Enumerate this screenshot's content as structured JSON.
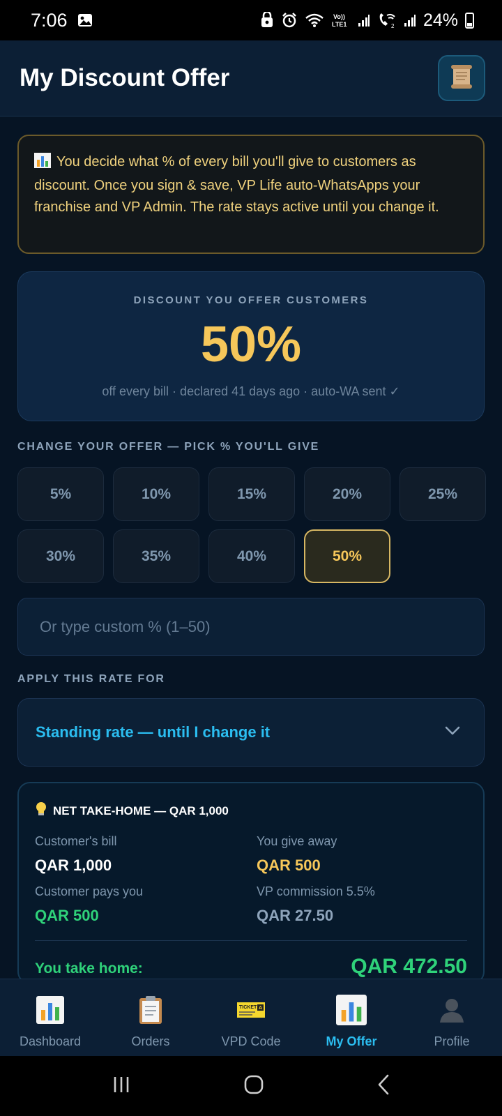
{
  "status_bar": {
    "time": "7:06",
    "battery": "24%",
    "icons": [
      "gallery-icon",
      "vpn-icon",
      "alarm-icon",
      "wifi-icon",
      "volte-icon",
      "signal-icon",
      "wifi-calling-icon",
      "signal-icon",
      "battery-icon"
    ]
  },
  "header": {
    "title": "My Discount Offer",
    "scroll_icon": "scroll-icon"
  },
  "info": {
    "icon": "bar-chart-icon",
    "text": "You decide what % of every bill you'll give to customers as discount. Once you sign & save, VP Life auto-WhatsApps your franchise and VP Admin. The rate stays active until you change it."
  },
  "discount_card": {
    "label": "DISCOUNT YOU OFFER CUSTOMERS",
    "value": "50%",
    "subtext": "off every bill · declared 41 days ago · auto-WA sent ✓"
  },
  "change_offer": {
    "label": "CHANGE YOUR OFFER — PICK % YOU'LL GIVE",
    "options": [
      "5%",
      "10%",
      "15%",
      "20%",
      "25%",
      "30%",
      "35%",
      "40%",
      "50%"
    ],
    "selected": "50%"
  },
  "custom_input": {
    "placeholder": "Or type custom % (1–50)",
    "value": ""
  },
  "apply": {
    "label": "APPLY THIS RATE FOR",
    "selected": "Standing rate — until I change it"
  },
  "net": {
    "title": "NET TAKE-HOME — QAR 1,000",
    "icon": "lightbulb-icon",
    "customer_bill_label": "Customer's bill",
    "customer_bill_value": "QAR 1,000",
    "give_away_label": "You give away",
    "give_away_value": "QAR 500",
    "customer_pays_label": "Customer pays you",
    "customer_pays_value": "QAR 500",
    "commission_label": "VP commission 5.5%",
    "commission_value": "QAR 27.50",
    "take_home_label": "You take home:",
    "take_home_value": "QAR 472.50"
  },
  "bottom_nav": [
    {
      "label": "Dashboard",
      "icon": "bar-chart-icon",
      "active": false
    },
    {
      "label": "Orders",
      "icon": "clipboard-icon",
      "active": false
    },
    {
      "label": "VPD Code",
      "icon": "ticket-icon",
      "active": false
    },
    {
      "label": "My Offer",
      "icon": "bar-chart-icon",
      "active": true
    },
    {
      "label": "Profile",
      "icon": "profile-icon",
      "active": false
    }
  ],
  "colors": {
    "accent_gold": "#f6c75a",
    "accent_cyan": "#2bbdf0",
    "accent_green": "#2fd27a",
    "background": "#061424"
  }
}
